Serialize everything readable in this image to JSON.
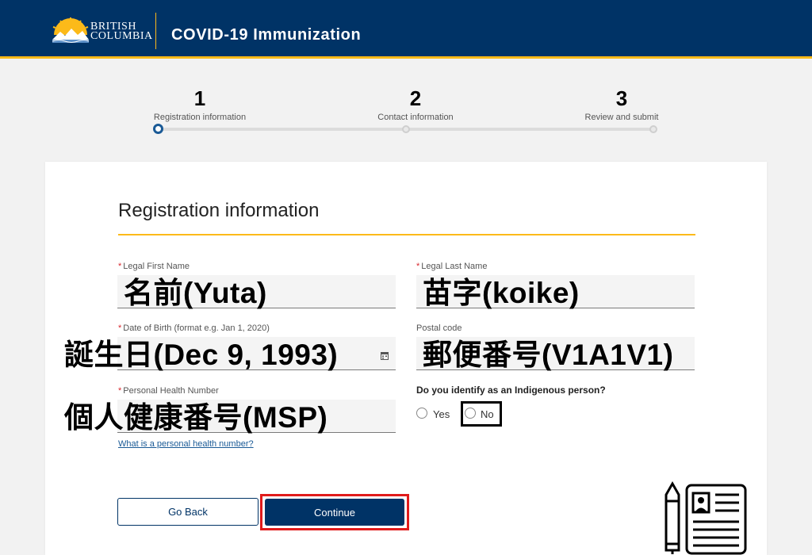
{
  "header": {
    "logo_text": "BRITISH\nCOLUMBIA",
    "title": "COVID-19 Immunization",
    "background_color": "#003366",
    "accent_color": "#fcba19"
  },
  "stepper": {
    "steps": [
      {
        "number": "1",
        "label": "Registration information",
        "active": true
      },
      {
        "number": "2",
        "label": "Contact information",
        "active": false
      },
      {
        "number": "3",
        "label": "Review and submit",
        "active": false
      }
    ]
  },
  "form": {
    "title": "Registration information",
    "required_marker": "*",
    "first_name": {
      "label": "Legal First Name",
      "value": "名前(Yuta)"
    },
    "last_name": {
      "label": "Legal Last Name",
      "value": "苗字(koike)"
    },
    "dob": {
      "label": "Date of Birth (format e.g. Jan 1, 2020)",
      "value": "誕生日(Dec 9, 1993)"
    },
    "postal": {
      "label": "Postal code",
      "value": "郵便番号(V1A1V1)"
    },
    "phn": {
      "label": "Personal Health Number",
      "value": "個人健康番号(MSP)"
    },
    "phn_help_link": "What is a personal health number?",
    "indigenous": {
      "question": "Do you identify as an Indigenous person?",
      "options": [
        "Yes",
        "No"
      ],
      "highlighted": "No"
    },
    "buttons": {
      "back": "Go Back",
      "continue": "Continue"
    }
  }
}
